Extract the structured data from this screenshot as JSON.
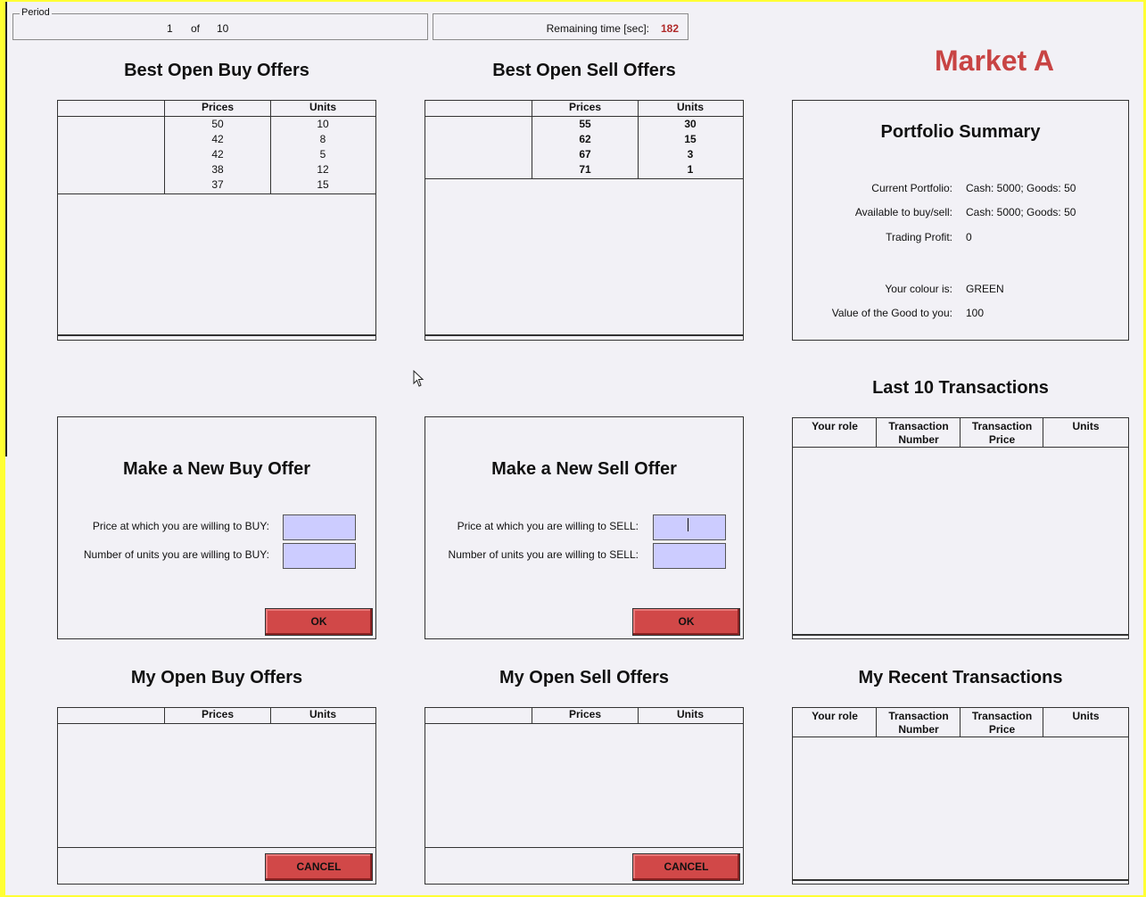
{
  "period": {
    "legend": "Period",
    "current": "1",
    "of_label": "of",
    "total": "10"
  },
  "timer": {
    "label": "Remaining time [sec]:",
    "value": "182"
  },
  "market_title": "Market A",
  "best_buy": {
    "title": "Best Open Buy Offers",
    "headers": [
      "",
      "Prices",
      "Units"
    ],
    "rows": [
      {
        "price": "50",
        "units": "10"
      },
      {
        "price": "42",
        "units": "8"
      },
      {
        "price": "42",
        "units": "5"
      },
      {
        "price": "38",
        "units": "12"
      },
      {
        "price": "37",
        "units": "15"
      }
    ]
  },
  "best_sell": {
    "title": "Best Open Sell Offers",
    "headers": [
      "",
      "Prices",
      "Units"
    ],
    "rows": [
      {
        "price": "55",
        "units": "30"
      },
      {
        "price": "62",
        "units": "15"
      },
      {
        "price": "67",
        "units": "3"
      },
      {
        "price": "71",
        "units": "1"
      }
    ]
  },
  "portfolio": {
    "title": "Portfolio Summary",
    "current_label": "Current Portfolio:",
    "current_value": "Cash: 5000; Goods: 50",
    "available_label": "Available to buy/sell:",
    "available_value": "Cash: 5000; Goods: 50",
    "profit_label": "Trading Profit:",
    "profit_value": "0",
    "colour_label": "Your colour is:",
    "colour_value": "GREEN",
    "good_value_label": "Value of the Good to you:",
    "good_value": "100"
  },
  "last10": {
    "title": "Last 10 Transactions",
    "headers": [
      "Your role",
      "Transaction Number",
      "Transaction Price",
      "Units"
    ]
  },
  "buy_form": {
    "title": "Make a New Buy Offer",
    "price_label": "Price at which you are willing to BUY:",
    "units_label": "Number of units you are willing to BUY:",
    "price_value": "",
    "units_value": "",
    "ok_label": "OK"
  },
  "sell_form": {
    "title": "Make a New Sell Offer",
    "price_label": "Price at which you are willing to SELL:",
    "units_label": "Number of units you are willing to SELL:",
    "price_value": "",
    "units_value": "",
    "ok_label": "OK"
  },
  "my_buy": {
    "title": "My Open Buy Offers",
    "headers": [
      "",
      "Prices",
      "Units"
    ],
    "cancel_label": "CANCEL"
  },
  "my_sell": {
    "title": "My Open Sell Offers",
    "headers": [
      "",
      "Prices",
      "Units"
    ],
    "cancel_label": "CANCEL"
  },
  "recent": {
    "title": "My Recent Transactions",
    "headers": [
      "Your role",
      "Transaction Number",
      "Transaction Price",
      "Units"
    ]
  },
  "colors": {
    "accent_red": "#c84444",
    "button_red": "#d14848",
    "input_lavender": "#ccccff",
    "timer_red": "#b02a2a",
    "frame_yellow": "#ffff33"
  }
}
